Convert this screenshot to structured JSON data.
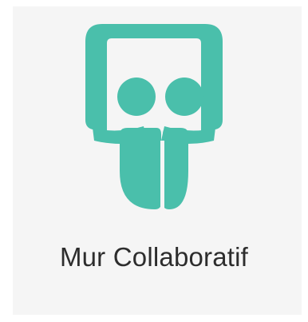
{
  "app": {
    "label": "Mur Collaboratif",
    "icon": "collaborative-board-icon",
    "accent_color": "#4ABFAB",
    "tile_background": "#F5F5F5",
    "text_color": "#2D2D2D"
  }
}
